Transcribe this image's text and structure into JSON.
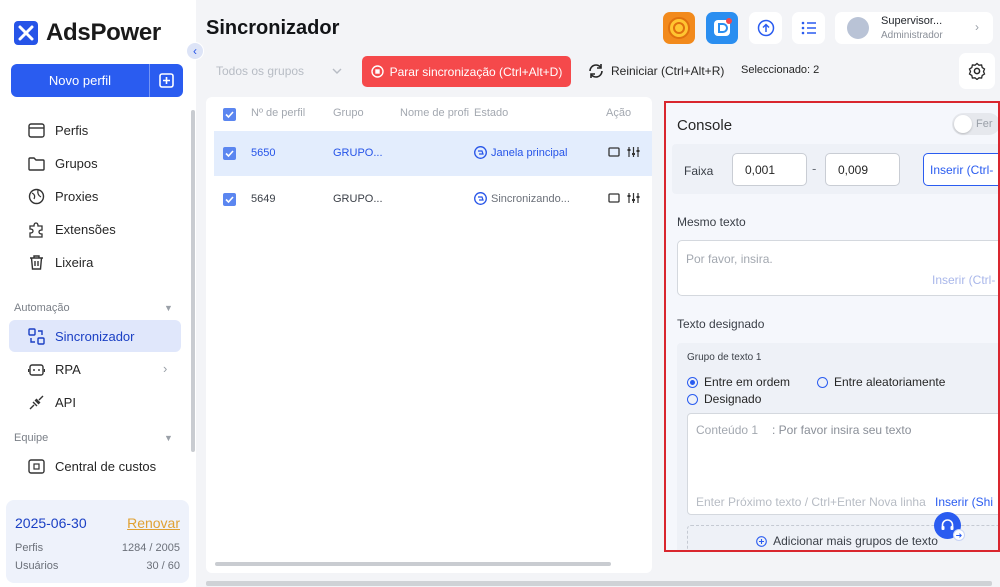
{
  "app": {
    "brand": "AdsPower",
    "page_title": "Sincronizador"
  },
  "sidebar": {
    "new_profile": "Novo perfil",
    "items": [
      {
        "label": "Perfis",
        "icon": "browser-window-icon"
      },
      {
        "label": "Grupos",
        "icon": "folder-icon"
      },
      {
        "label": "Proxies",
        "icon": "globe-icon"
      },
      {
        "label": "Extensões",
        "icon": "puzzle-icon"
      },
      {
        "label": "Lixeira",
        "icon": "trash-icon"
      }
    ],
    "section_automation": "Automação",
    "automation_items": [
      {
        "label": "Sincronizador",
        "icon": "sync-windows-icon",
        "active": true
      },
      {
        "label": "RPA",
        "icon": "robot-icon"
      },
      {
        "label": "API",
        "icon": "plug-icon"
      }
    ],
    "section_team": "Equipe",
    "team_items": [
      {
        "label": "Central de custos",
        "icon": "wallet-icon"
      }
    ],
    "plan": {
      "date": "2025-06-30",
      "renew": "Renovar",
      "profiles_label": "Perfis",
      "profiles_value": "1284 / 2005",
      "users_label": "Usuários",
      "users_value": "30 / 60"
    }
  },
  "header": {
    "user_name": "Supervisor...",
    "user_role": "Administrador"
  },
  "toolbar": {
    "group_placeholder": "Todos os grupos",
    "stop_sync": "Parar sincronização (Ctrl+Alt+D)",
    "restart": "Reiniciar (Ctrl+Alt+R)",
    "selected": "Seleccionado: 2"
  },
  "table": {
    "columns": [
      "Nº de perfil",
      "Grupo",
      "Nome de profi",
      "Estado",
      "Ação"
    ],
    "rows": [
      {
        "id": "5650",
        "group": "GRUPO...",
        "name": "",
        "state": "Janela principal",
        "selected": true
      },
      {
        "id": "5649",
        "group": "GRUPO...",
        "name": "",
        "state": "Sincronizando...",
        "selected": false
      }
    ]
  },
  "console": {
    "title": "Console",
    "toggle_label": "Fer",
    "range_label": "Faixa",
    "range_min": "0,001",
    "range_sep": "-",
    "range_max": "0,009",
    "range_insert": "Inserir (Ctrl-",
    "same_text_label": "Mesmo texto",
    "same_text_placeholder": "Por favor, insira.",
    "same_text_insert": "Inserir (Ctrl-",
    "designated_label": "Texto designado",
    "group_title": "Grupo de texto 1",
    "radio_order": "Entre em ordem",
    "radio_random": "Entre aleatoriamente",
    "radio_designated": "Designado",
    "content_label": "Conteúdo 1",
    "content_placeholder": ": Por favor insira seu texto",
    "content_hint": "Enter Próximo texto / Ctrl+Enter Nova linha",
    "content_insert": "Inserir (Shi",
    "add_groups": "Adicionar mais grupos de texto"
  },
  "colors": {
    "accent": "#2a5cf0",
    "danger": "#f5494b",
    "highlight_border": "#d9262e"
  }
}
